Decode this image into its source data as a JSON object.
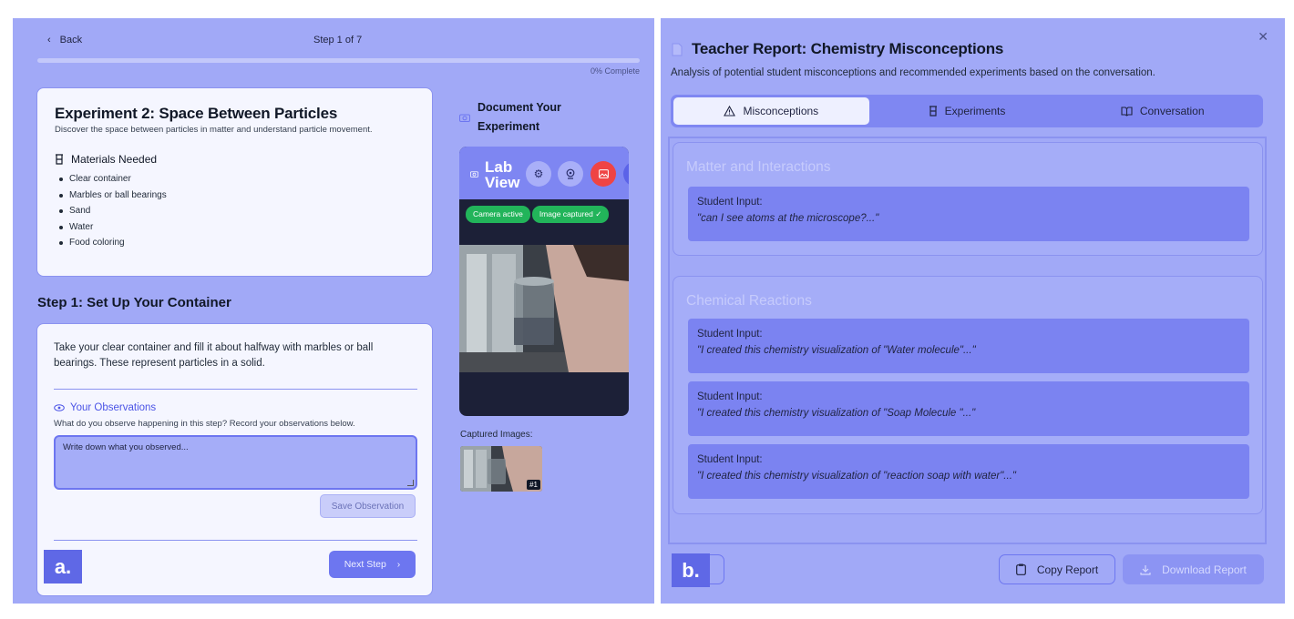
{
  "panel_a": {
    "label": "a.",
    "nav": {
      "back_label": "Back",
      "step_counter": "Step 1 of 7"
    },
    "progress": {
      "value_percent": 0,
      "text": "0% Complete"
    },
    "experiment": {
      "title": "Experiment 2: Space Between Particles",
      "subtitle": "Discover the space between particles in matter and understand particle movement.",
      "materials_heading": "Materials Needed",
      "materials": [
        "Clear container",
        "Marbles or ball bearings",
        "Sand",
        "Water",
        "Food coloring"
      ]
    },
    "step": {
      "title": "Step 1: Set Up Your Container",
      "instructions": "Take your clear container and fill it about halfway with marbles or ball bearings. These represent particles in a solid.",
      "observations_heading": "Your Observations",
      "observations_prompt": "What do you observe happening in this step? Record your observations below.",
      "observations_placeholder": "Write down what you observed...",
      "save_label": "Save Observation",
      "next_label": "Next Step"
    },
    "document": {
      "title": "Document Your Experiment",
      "lab_title_line1": "Lab",
      "lab_title_line2": "View",
      "badge_camera": "Camera active",
      "badge_captured": "Image captured ✓",
      "captured_label": "Captured Images:",
      "thumb_number": "#1"
    }
  },
  "panel_b": {
    "label": "b.",
    "title": "Teacher Report: Chemistry Misconceptions",
    "subtitle": "Analysis of potential student misconceptions and recommended experiments based on the conversation.",
    "tabs": [
      {
        "label": "Misconceptions",
        "icon": "warning-triangle-icon"
      },
      {
        "label": "Experiments",
        "icon": "flask-icon"
      },
      {
        "label": "Conversation",
        "icon": "book-open-icon"
      }
    ],
    "sections": [
      {
        "title": "Matter and Interactions",
        "entries": [
          {
            "label": "Student Input:",
            "quote": "\"can I see atoms at the microscope?...\""
          }
        ]
      },
      {
        "title": "Chemical Reactions",
        "entries": [
          {
            "label": "Student Input:",
            "quote": "\"I created this chemistry visualization of \"Water molecule\"...\""
          },
          {
            "label": "Student Input:",
            "quote": "\"I created this chemistry visualization of \"Soap Molecule \"...\""
          },
          {
            "label": "Student Input:",
            "quote": "\"I created this chemistry visualization of \"reaction soap with water\"...\""
          }
        ]
      }
    ],
    "footer": {
      "copy_label": "Copy Report",
      "download_label": "Download Report"
    }
  },
  "colors": {
    "accent": "#6d76f0",
    "panel_bg": "#a1a9f7",
    "success": "#22b45a",
    "danger": "#ef4444"
  }
}
